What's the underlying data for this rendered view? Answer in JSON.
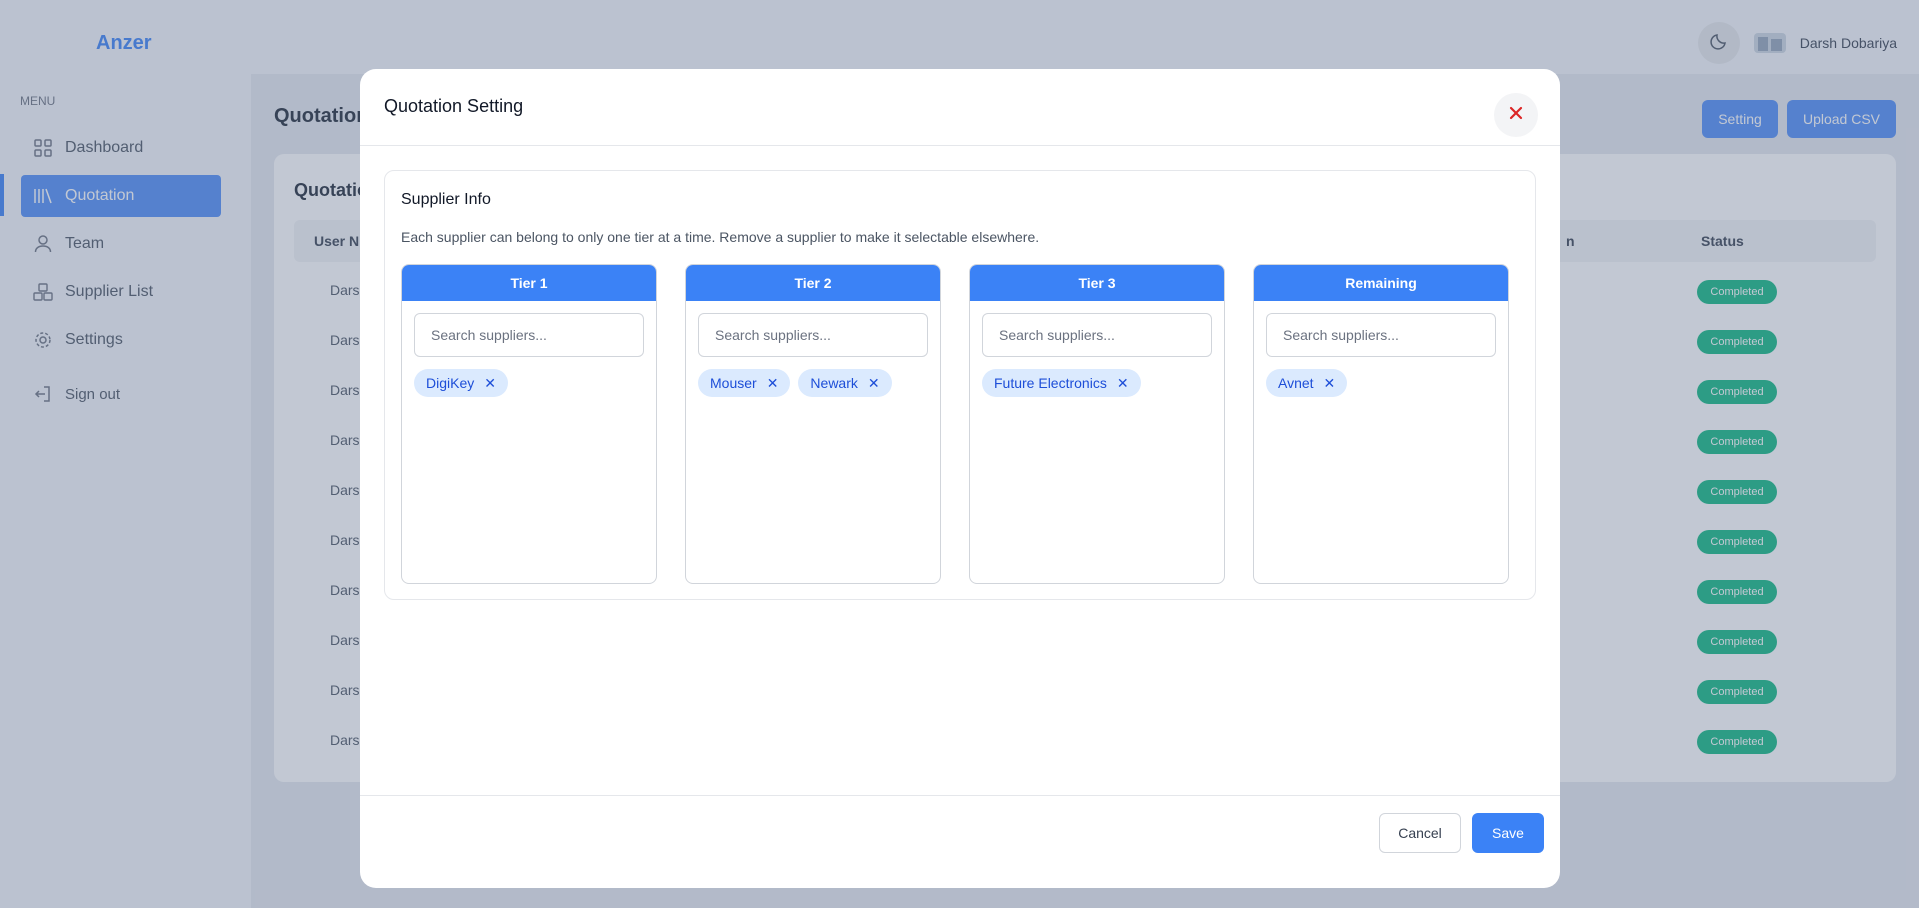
{
  "app": {
    "logo": "Anzer"
  },
  "sidebar": {
    "menu_caption": "MENU",
    "items": [
      {
        "label": "Dashboard",
        "icon": "grid-icon",
        "active": false
      },
      {
        "label": "Quotation",
        "icon": "books-icon",
        "active": true
      },
      {
        "label": "Team",
        "icon": "user-icon",
        "active": false
      },
      {
        "label": "Supplier List",
        "icon": "boxes-icon",
        "active": false
      },
      {
        "label": "Settings",
        "icon": "gear-icon",
        "active": false
      }
    ],
    "signout_label": "Sign out"
  },
  "topbar": {
    "user_name": "Darsh Dobariya"
  },
  "page": {
    "title": "Quotation",
    "setting_button": "Setting",
    "upload_button": "Upload CSV",
    "card_title": "Quotation",
    "table": {
      "col_user": "User N",
      "col_partial": "n",
      "col_status": "Status",
      "rows": [
        {
          "user": "Darsh D",
          "status": "Completed"
        },
        {
          "user": "Darsh D",
          "status": "Completed"
        },
        {
          "user": "Darsh D",
          "status": "Completed"
        },
        {
          "user": "Darshku",
          "status": "Completed"
        },
        {
          "user": "Darshku",
          "status": "Completed"
        },
        {
          "user": "Darshku",
          "status": "Completed"
        },
        {
          "user": "Darshku",
          "status": "Completed"
        },
        {
          "user": "Darshku",
          "status": "Completed"
        },
        {
          "user": "Darshku",
          "status": "Completed"
        },
        {
          "user": "Darshku",
          "status": "Completed"
        }
      ]
    }
  },
  "modal": {
    "title": "Quotation Setting",
    "supplier_info": {
      "title": "Supplier Info",
      "description": "Each supplier can belong to only one tier at a time. Remove a supplier to make it selectable elsewhere.",
      "search_placeholder": "Search suppliers...",
      "tiers": [
        {
          "name": "Tier 1",
          "suppliers": [
            "DigiKey"
          ]
        },
        {
          "name": "Tier 2",
          "suppliers": [
            "Mouser",
            "Newark"
          ]
        },
        {
          "name": "Tier 3",
          "suppliers": [
            "Future Electronics"
          ]
        },
        {
          "name": "Remaining",
          "suppliers": [
            "Avnet"
          ]
        }
      ]
    },
    "cancel_label": "Cancel",
    "save_label": "Save"
  },
  "colors": {
    "accent": "#3b82f6",
    "status_completed": "#10b981",
    "close_icon": "#dc2626"
  }
}
